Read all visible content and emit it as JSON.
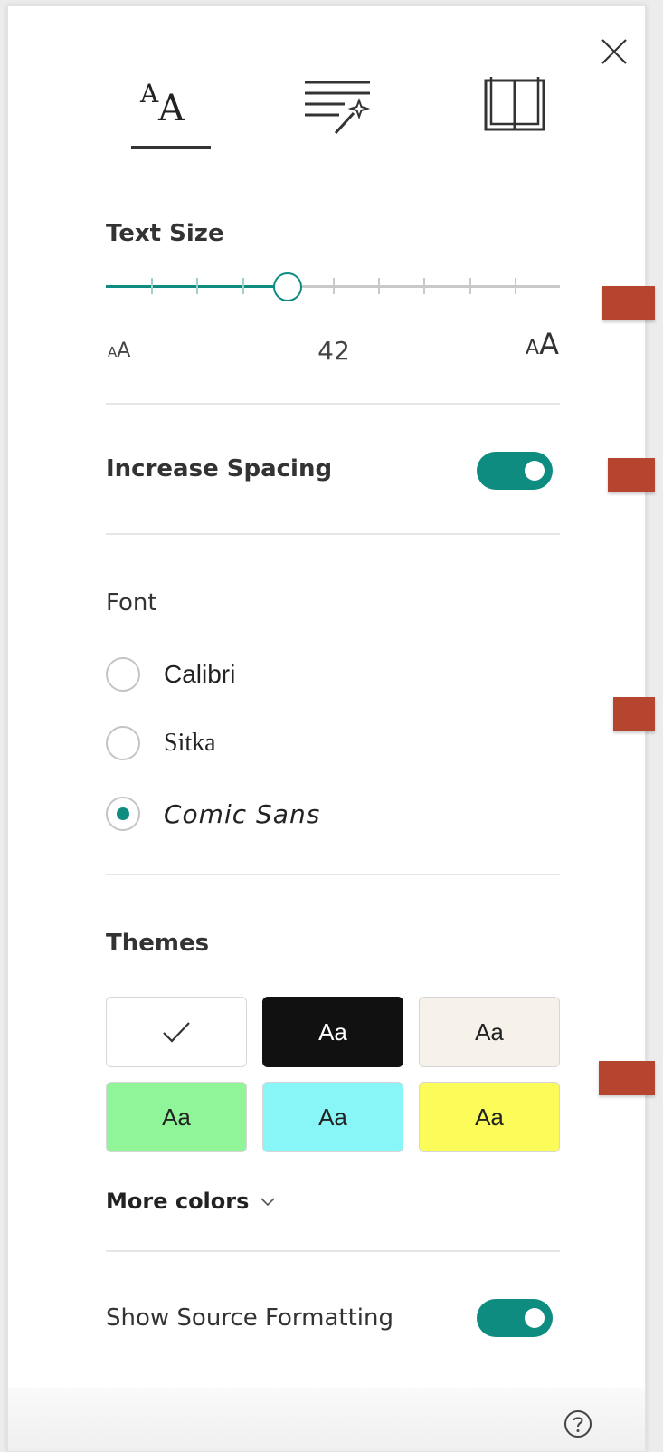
{
  "tabs": [
    {
      "name": "text-options",
      "label": "A",
      "label_small": "A"
    },
    {
      "name": "grammar-tools"
    },
    {
      "name": "reading-preferences"
    }
  ],
  "text_size": {
    "title": "Text Size",
    "value": "42",
    "min_label_small": "A",
    "min_label_large": "A",
    "max_label_small": "A",
    "max_label_large": "A",
    "slider_fraction": 0.4
  },
  "spacing": {
    "label": "Increase Spacing",
    "enabled": true
  },
  "font": {
    "title": "Font",
    "options": [
      {
        "label": "Calibri",
        "selected": false
      },
      {
        "label": "Sitka",
        "selected": false
      },
      {
        "label": "Comic Sans",
        "selected": true
      }
    ]
  },
  "themes": {
    "title": "Themes",
    "swatch_label": "Aa",
    "swatches": [
      {
        "bg": "#ffffff",
        "fg": "#222222",
        "selected": true
      },
      {
        "bg": "#111111",
        "fg": "#ffffff",
        "selected": false
      },
      {
        "bg": "#f6f2ea",
        "fg": "#222222",
        "selected": false
      },
      {
        "bg": "#8ff598",
        "fg": "#222222",
        "selected": false
      },
      {
        "bg": "#88f6f6",
        "fg": "#222222",
        "selected": false
      },
      {
        "bg": "#fbfb5a",
        "fg": "#222222",
        "selected": false
      }
    ],
    "more_colors_label": "More colors"
  },
  "source_formatting": {
    "label": "Show Source Formatting",
    "enabled": true
  },
  "colors": {
    "accent": "#0e8c80",
    "marker": "#b5452f"
  },
  "icons": {
    "close": "close-icon",
    "text_options": "text-options-icon",
    "grammar": "grammar-tools-icon",
    "reading": "book-icon",
    "help": "help-icon",
    "chevron": "chevron-down-icon",
    "check": "checkmark-icon"
  }
}
